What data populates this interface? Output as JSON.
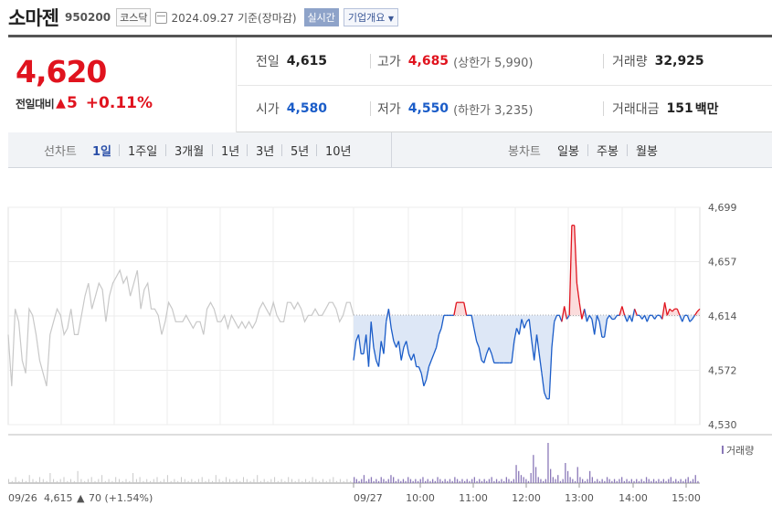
{
  "header": {
    "stock_name": "소마젠",
    "stock_code": "950200",
    "market": "코스닥",
    "date_text": "2024.09.27 기준(장마감)",
    "realtime_label": "실시간",
    "company_overview_label": "기업개요"
  },
  "quote": {
    "current_price": "4,620",
    "change_label": "전일대비",
    "change_arrow": "▲",
    "change_amount": "5",
    "change_percent": "+0.11%",
    "prev_close_label": "전일",
    "prev_close": "4,615",
    "high_label": "고가",
    "high": "4,685",
    "upper_limit": "(상한가 5,990)",
    "volume_label": "거래량",
    "volume": "32,925",
    "open_label": "시가",
    "open": "4,580",
    "low_label": "저가",
    "low": "4,550",
    "lower_limit": "(하한가 3,235)",
    "trade_value_label": "거래대금",
    "trade_value": "151",
    "trade_value_unit": "백만"
  },
  "tabs": {
    "line_chart_label": "선차트",
    "periods": [
      "1일",
      "1주일",
      "3개월",
      "1년",
      "3년",
      "5년",
      "10년"
    ],
    "selected_period": "1일",
    "candle_chart_label": "봉차트",
    "candle_periods": [
      "일봉",
      "주봉",
      "월봉"
    ]
  },
  "colors": {
    "up": "#e0131e",
    "down": "#1a5cc8",
    "up_fill": "#fbdcdc",
    "down_fill": "#dde7f6",
    "prev_day_line": "#c8c8c8",
    "volume_bar": "#8a78b8"
  },
  "chart_data": {
    "type": "line",
    "y_ticks": [
      "4,699",
      "4,657",
      "4,614",
      "4,572",
      "4,530"
    ],
    "ylim": [
      4530,
      4699
    ],
    "baseline": 4615,
    "volume_legend": "거래량",
    "prev_day": {
      "date_label": "09/26",
      "close_text": "4,615",
      "change_arrow": "▲",
      "change_text": "70 (+1.54%)",
      "values": [
        4600,
        4560,
        4620,
        4610,
        4580,
        4570,
        4620,
        4615,
        4600,
        4580,
        4570,
        4560,
        4600,
        4610,
        4620,
        4615,
        4600,
        4605,
        4620,
        4600,
        4600,
        4615,
        4630,
        4640,
        4620,
        4630,
        4640,
        4635,
        4610,
        4630,
        4640,
        4645,
        4650,
        4640,
        4645,
        4630,
        4640,
        4650,
        4620,
        4635,
        4640,
        4620,
        4620,
        4615,
        4600,
        4610,
        4625,
        4620,
        4610,
        4610,
        4610,
        4615,
        4610,
        4605,
        4610,
        4610,
        4600,
        4620,
        4625,
        4620,
        4610,
        4610,
        4615,
        4605,
        4615,
        4610,
        4605,
        4610,
        4605,
        4610,
        4605,
        4610,
        4620,
        4625,
        4620,
        4615,
        4625,
        4615,
        4610,
        4610,
        4625,
        4625,
        4620,
        4625,
        4620,
        4610,
        4615,
        4615,
        4620,
        4615,
        4615,
        4620,
        4625,
        4625,
        4620,
        4610,
        4615,
        4625,
        4625,
        4615
      ]
    },
    "today": {
      "date_label": "09/27",
      "x_ticks": [
        "10:00",
        "11:00",
        "12:00",
        "13:00",
        "14:00",
        "15:00"
      ],
      "values": [
        4580,
        4595,
        4600,
        4585,
        4585,
        4600,
        4575,
        4610,
        4590,
        4580,
        4575,
        4595,
        4585,
        4610,
        4620,
        4605,
        4595,
        4590,
        4595,
        4580,
        4590,
        4595,
        4585,
        4580,
        4585,
        4575,
        4575,
        4570,
        4560,
        4565,
        4575,
        4580,
        4585,
        4590,
        4600,
        4605,
        4615,
        4615,
        4615,
        4615,
        4615,
        4625,
        4625,
        4625,
        4625,
        4615,
        4615,
        4615,
        4605,
        4595,
        4590,
        4580,
        4578,
        4585,
        4590,
        4585,
        4578,
        4578,
        4578,
        4578,
        4578,
        4578,
        4578,
        4578,
        4595,
        4605,
        4600,
        4612,
        4605,
        4610,
        4612,
        4595,
        4580,
        4600,
        4585,
        4570,
        4555,
        4550,
        4550,
        4590,
        4610,
        4615,
        4615,
        4610,
        4622,
        4612,
        4615,
        4685,
        4685,
        4640,
        4625,
        4612,
        4620,
        4610,
        4615,
        4612,
        4600,
        4615,
        4610,
        4598,
        4598,
        4612,
        4615,
        4612,
        4612,
        4615,
        4615,
        4622,
        4615,
        4610,
        4615,
        4610,
        4620,
        4615,
        4615,
        4612,
        4615,
        4610,
        4615,
        4615,
        4612,
        4615,
        4615,
        4612,
        4625,
        4615,
        4620,
        4618,
        4620,
        4620,
        4615,
        4610,
        4615,
        4615,
        4610,
        4612,
        4615,
        4618,
        4620
      ]
    },
    "volume": {
      "prev_day": [
        2,
        1,
        3,
        1,
        2,
        1,
        4,
        2,
        1,
        3,
        2,
        1,
        5,
        2,
        1,
        2,
        3,
        1,
        2,
        1,
        6,
        2,
        1,
        2,
        3,
        1,
        2,
        4,
        1,
        2,
        1,
        3,
        2,
        1,
        2,
        1,
        5,
        2,
        3,
        1,
        2,
        1,
        2,
        3,
        1,
        2,
        4,
        1,
        2,
        1,
        3,
        2,
        1,
        2,
        1,
        2,
        3,
        1,
        2,
        1,
        4,
        2,
        1,
        3,
        2,
        1,
        2,
        1,
        3,
        2,
        1,
        2,
        4,
        1,
        2,
        1,
        2,
        3,
        1,
        2,
        1,
        3,
        2,
        1,
        2,
        1,
        2,
        1,
        3,
        2,
        1,
        2,
        1,
        2,
        3,
        1,
        2,
        1,
        2,
        1
      ],
      "today": [
        3,
        2,
        1,
        2,
        4,
        1,
        2,
        3,
        1,
        2,
        1,
        3,
        2,
        1,
        2,
        4,
        3,
        1,
        2,
        1,
        2,
        1,
        3,
        2,
        1,
        2,
        1,
        2,
        3,
        1,
        2,
        1,
        2,
        1,
        3,
        2,
        1,
        2,
        1,
        2,
        1,
        3,
        2,
        1,
        2,
        1,
        2,
        1,
        2,
        3,
        1,
        2,
        1,
        2,
        1,
        2,
        3,
        1,
        2,
        1,
        2,
        1,
        3,
        2,
        1,
        2,
        9,
        6,
        4,
        3,
        2,
        1,
        5,
        14,
        8,
        3,
        2,
        1,
        2,
        20,
        7,
        3,
        2,
        4,
        1,
        2,
        10,
        6,
        3,
        2,
        1,
        8,
        3,
        2,
        1,
        2,
        6,
        3,
        1,
        2,
        1,
        2,
        1,
        3,
        2,
        1,
        2,
        1,
        2,
        3,
        1,
        2,
        1,
        2,
        1,
        2,
        1,
        2,
        1,
        3,
        2,
        1,
        2,
        1,
        2,
        1,
        2,
        1,
        2,
        3,
        1,
        2,
        1,
        2,
        1,
        2,
        3,
        1,
        2,
        4,
        1
      ]
    }
  }
}
